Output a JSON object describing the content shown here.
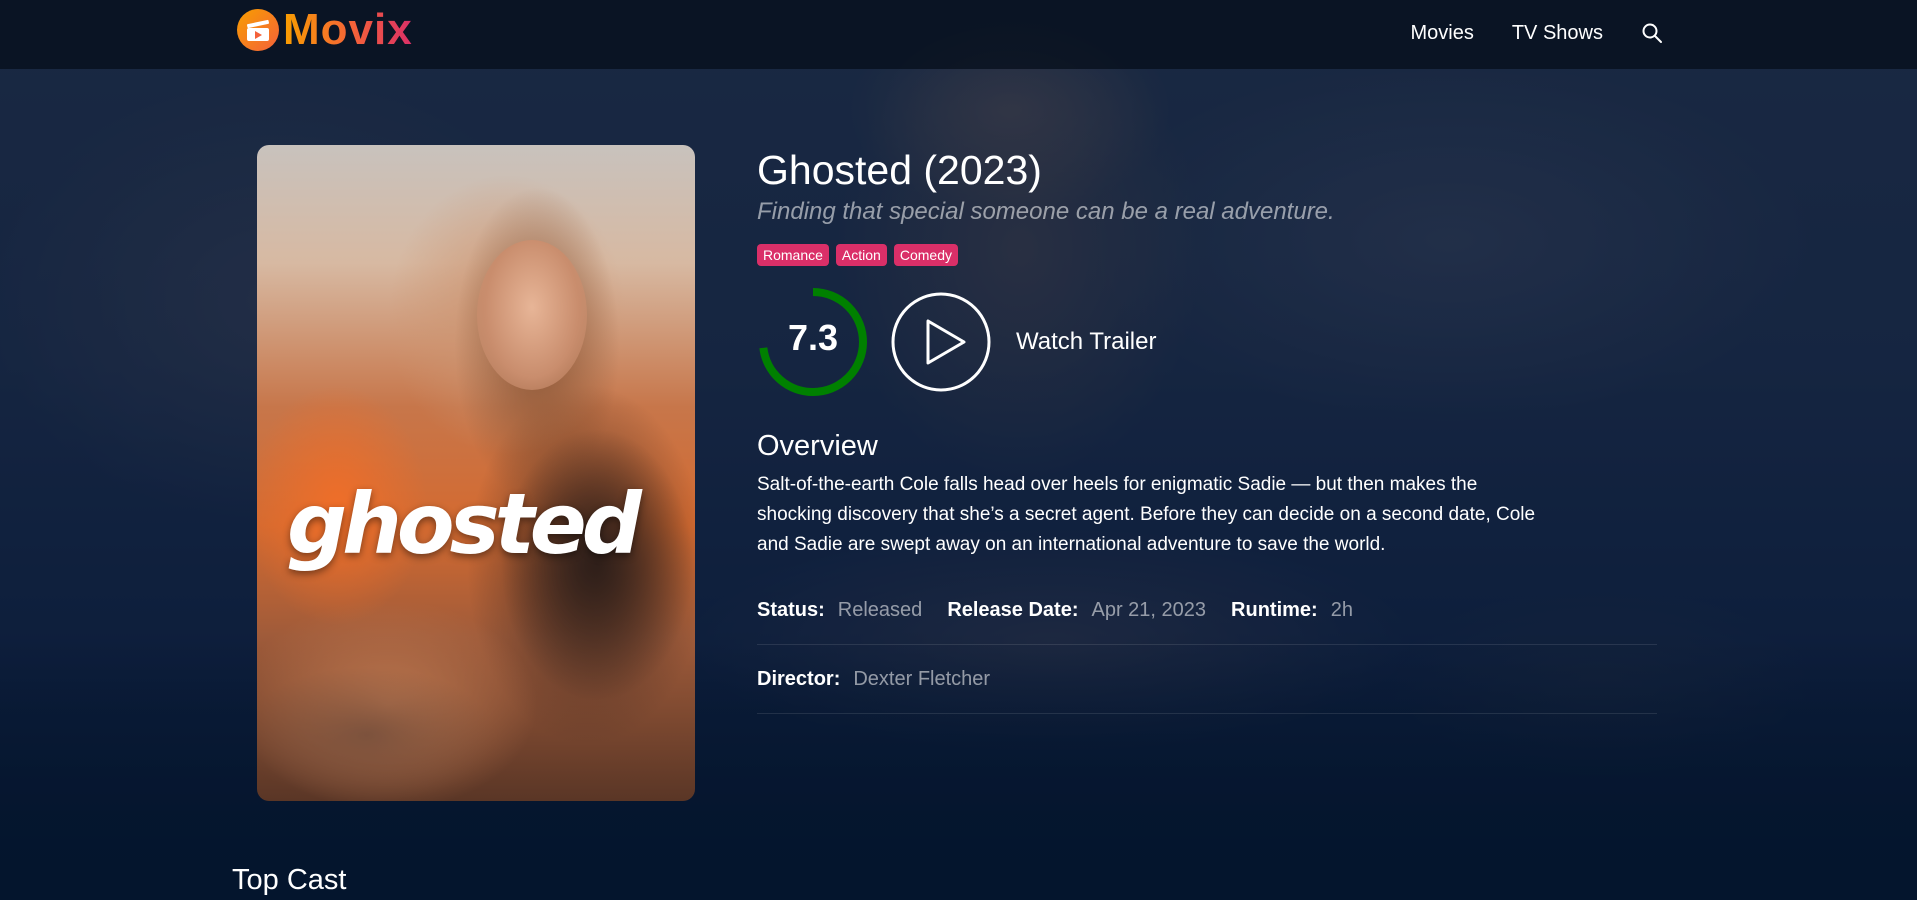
{
  "header": {
    "logo_text": "Movix",
    "nav": [
      "Movies",
      "TV Shows"
    ]
  },
  "movie": {
    "title": "Ghosted (2023)",
    "tagline": "Finding that special someone can be a real adventure.",
    "poster_title": "ghosted",
    "genres": [
      "Romance",
      "Action",
      "Comedy"
    ],
    "rating": "7.3",
    "rating_fraction": 0.73,
    "trailer_label": "Watch Trailer",
    "overview_heading": "Overview",
    "overview": "Salt-of-the-earth Cole falls head over heels for enigmatic Sadie — but then makes the shocking discovery that she’s a secret agent. Before they can decide on a second date, Cole and Sadie are swept away on an international adventure to save the world.",
    "info": {
      "status_label": "Status:",
      "status_value": "Released",
      "release_label": "Release Date:",
      "release_value": "Apr 21, 2023",
      "runtime_label": "Runtime:",
      "runtime_value": "2h",
      "director_label": "Director:",
      "director_value": "Dexter Fletcher"
    }
  },
  "top_cast": {
    "heading": "Top Cast"
  },
  "colors": {
    "background": "#04152d",
    "accent_pink": "#da2f68",
    "accent_orange": "#f89e00",
    "rating_green": "#008000"
  }
}
